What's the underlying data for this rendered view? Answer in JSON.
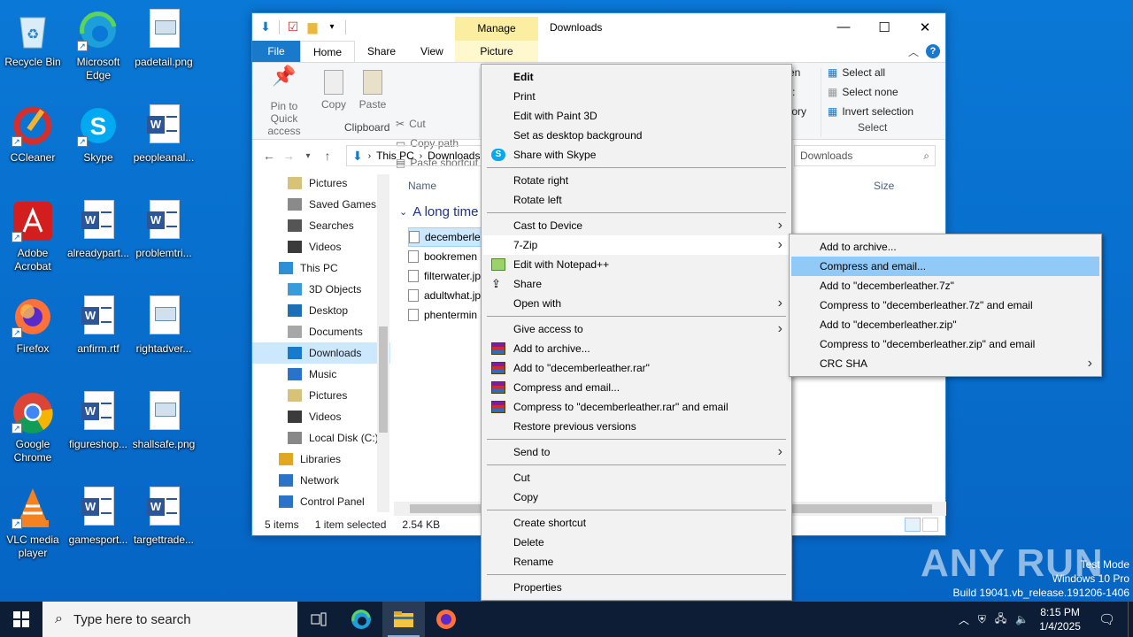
{
  "desktop": {
    "icons": [
      {
        "label": "Recycle Bin",
        "icon": "recycle-bin-icon"
      },
      {
        "label": "Microsoft Edge",
        "icon": "edge-icon"
      },
      {
        "label": "padetail.png",
        "icon": "image-file-icon"
      },
      {
        "label": "CCleaner",
        "icon": "ccleaner-icon"
      },
      {
        "label": "Skype",
        "icon": "skype-icon"
      },
      {
        "label": "peopleanal...",
        "icon": "word-doc-icon"
      },
      {
        "label": "Adobe Acrobat",
        "icon": "acrobat-icon"
      },
      {
        "label": "alreadypart...",
        "icon": "word-doc-icon"
      },
      {
        "label": "problemtri...",
        "icon": "word-doc-icon"
      },
      {
        "label": "Firefox",
        "icon": "firefox-icon"
      },
      {
        "label": "anfirm.rtf",
        "icon": "word-doc-icon"
      },
      {
        "label": "rightadver...",
        "icon": "image-file-icon"
      },
      {
        "label": "Google Chrome",
        "icon": "chrome-icon"
      },
      {
        "label": "figureshop...",
        "icon": "word-doc-icon"
      },
      {
        "label": "shallsafe.png",
        "icon": "image-file-icon"
      },
      {
        "label": "VLC media player",
        "icon": "vlc-icon"
      },
      {
        "label": "gamesport...",
        "icon": "word-doc-icon"
      },
      {
        "label": "targettrade...",
        "icon": "word-doc-icon"
      }
    ]
  },
  "explorer": {
    "title": "Downloads",
    "manage_tab": "Manage",
    "tabs": {
      "file": "File",
      "home": "Home",
      "share": "Share",
      "view": "View",
      "picture_tools": "Picture Tools"
    },
    "ribbon": {
      "pin": "Pin to Quick access",
      "copy": "Copy",
      "paste": "Paste",
      "cut": "Cut",
      "copy_path": "Copy path",
      "paste_shortcut": "Paste shortcut",
      "clipboard": "Clipboard",
      "open_frag": "en",
      "history_frag": "tory",
      "select_all": "Select all",
      "select_none": "Select none",
      "invert_selection": "Invert selection",
      "select": "Select"
    },
    "address": {
      "this_pc": "This PC",
      "downloads": "Downloads"
    },
    "search_placeholder": "Downloads",
    "nav": [
      {
        "label": "Pictures",
        "indent": 1
      },
      {
        "label": "Saved Games",
        "indent": 1
      },
      {
        "label": "Searches",
        "indent": 1
      },
      {
        "label": "Videos",
        "indent": 1
      },
      {
        "label": "This PC",
        "indent": 0
      },
      {
        "label": "3D Objects",
        "indent": 1
      },
      {
        "label": "Desktop",
        "indent": 1
      },
      {
        "label": "Documents",
        "indent": 1
      },
      {
        "label": "Downloads",
        "indent": 1
      },
      {
        "label": "Music",
        "indent": 1
      },
      {
        "label": "Pictures",
        "indent": 1
      },
      {
        "label": "Videos",
        "indent": 1
      },
      {
        "label": "Local Disk (C:)",
        "indent": 1
      },
      {
        "label": "Libraries",
        "indent": 0
      },
      {
        "label": "Network",
        "indent": 0
      },
      {
        "label": "Control Panel",
        "indent": 0
      }
    ],
    "columns": {
      "name": "Name",
      "size": "Size"
    },
    "group": "A long time",
    "files": [
      "decemberle",
      "bookremen",
      "filterwater.jp",
      "adultwhat.jp",
      "phentermin"
    ],
    "status": {
      "items": "5 items",
      "selected": "1 item selected",
      "size": "2.54 KB"
    }
  },
  "context_menu": {
    "items": [
      {
        "label": "Edit",
        "bold": true
      },
      {
        "label": "Print"
      },
      {
        "label": "Edit with Paint 3D"
      },
      {
        "label": "Set as desktop background"
      },
      {
        "label": "Share with Skype",
        "icon": "skype"
      },
      {
        "sep": true
      },
      {
        "label": "Rotate right"
      },
      {
        "label": "Rotate left"
      },
      {
        "sep": true
      },
      {
        "label": "Cast to Device",
        "submenu": true
      },
      {
        "label": "7-Zip",
        "submenu": true,
        "hl": true
      },
      {
        "label": "Edit with Notepad++",
        "icon": "notepad"
      },
      {
        "label": "Share",
        "icon": "share"
      },
      {
        "label": "Open with",
        "submenu": true
      },
      {
        "sep": true
      },
      {
        "label": "Give access to",
        "submenu": true
      },
      {
        "label": "Add to archive...",
        "icon": "rar"
      },
      {
        "label": "Add to \"decemberleather.rar\"",
        "icon": "rar"
      },
      {
        "label": "Compress and email...",
        "icon": "rar"
      },
      {
        "label": "Compress to \"decemberleather.rar\" and email",
        "icon": "rar"
      },
      {
        "label": "Restore previous versions"
      },
      {
        "sep": true
      },
      {
        "label": "Send to",
        "submenu": true
      },
      {
        "sep": true
      },
      {
        "label": "Cut"
      },
      {
        "label": "Copy"
      },
      {
        "sep": true
      },
      {
        "label": "Create shortcut"
      },
      {
        "label": "Delete"
      },
      {
        "label": "Rename"
      },
      {
        "sep": true
      },
      {
        "label": "Properties"
      }
    ]
  },
  "submenu_7zip": {
    "items": [
      {
        "label": "Add to archive..."
      },
      {
        "label": "Compress and email...",
        "hl": true
      },
      {
        "label": "Add to \"decemberleather.7z\""
      },
      {
        "label": "Compress to \"decemberleather.7z\" and email"
      },
      {
        "label": "Add to \"decemberleather.zip\""
      },
      {
        "label": "Compress to \"decemberleather.zip\" and email"
      },
      {
        "label": "CRC SHA",
        "submenu": true
      }
    ]
  },
  "taskbar": {
    "search_placeholder": "Type here to search",
    "time": "8:15 PM",
    "date": "1/4/2025"
  },
  "watermark": {
    "brand": "ANY RUN",
    "test_mode": "Test Mode",
    "os": "Windows 10 Pro",
    "build": "Build 19041.vb_release.191206-1406"
  },
  "colors": {
    "desktop": "#0a78d6",
    "accent": "#1979ca",
    "menu_highlight": "#91c9f7",
    "selection": "#cce8ff"
  }
}
